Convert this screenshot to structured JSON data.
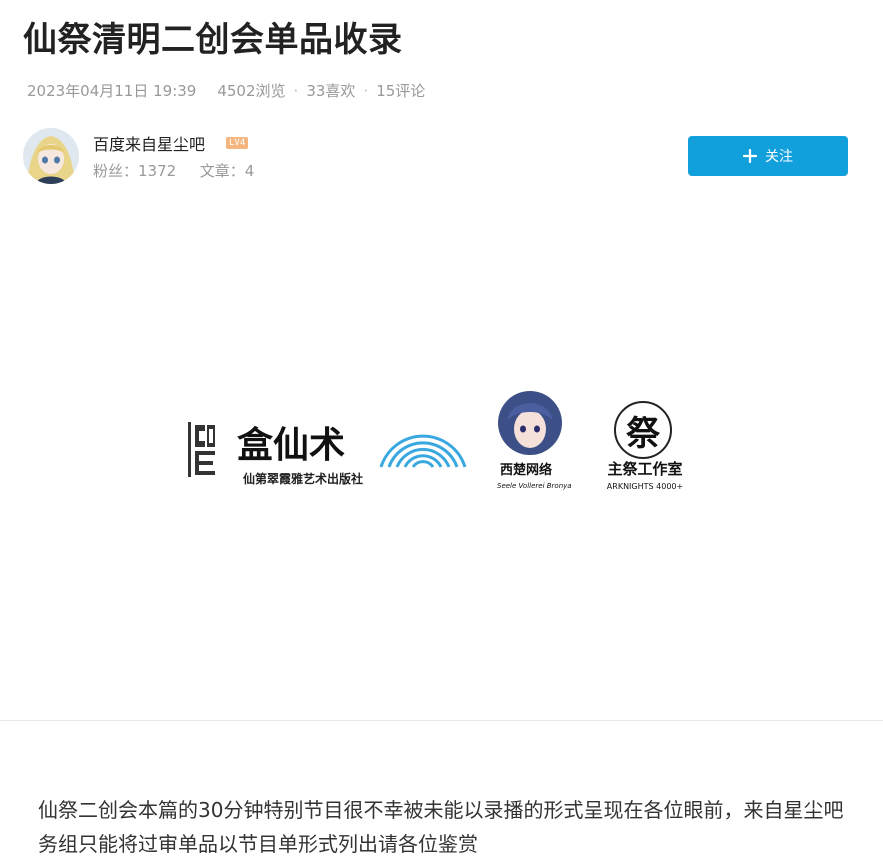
{
  "article": {
    "title": "仙祭清明二创会单品收录",
    "date": "2023年04月11日 19:39",
    "views": "4502浏览",
    "likes": "33喜欢",
    "comments": "15评论",
    "meta_separator": "·",
    "body": "仙祭二创会本篇的30分钟特别节目很不幸被未能以录播的形式呈现在各位眼前，来自星尘吧务组只能将过审单品以节目单形式列出请各位鉴赏"
  },
  "author": {
    "name": "百度来自星尘吧",
    "level": "LV4",
    "fans": "粉丝：1372",
    "articles": "文章：4",
    "follow_label": "关注"
  },
  "banner": {
    "logo1_char": "盒仙术",
    "logo1_subtitle": "仙第翠霞雅艺术出版社",
    "logo2_name": "西楚网络",
    "logo2_subtitle": "Seele Vollerei Bronya",
    "logo3_symbol": "祭",
    "logo3_name": "主祭工作室",
    "logo3_subtitle": "ARKNIGHTS 4000+"
  },
  "colors": {
    "accent": "#12a0dc",
    "level_badge": "#f5b57f",
    "logo_arc": "#3aa8e0"
  }
}
